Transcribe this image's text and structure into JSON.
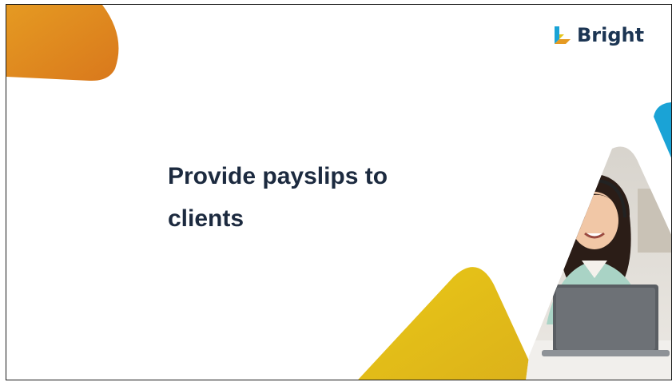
{
  "brand": {
    "name": "Bright",
    "logo_icon": "bright-logo-mark",
    "text_color": "#1c3553"
  },
  "slide": {
    "title": "Provide payslips to clients"
  },
  "colors": {
    "accent_orange": "#e08a1f",
    "accent_yellow": "#e6c51a",
    "accent_blue": "#1aa3d6",
    "title": "#1c2a3f"
  }
}
